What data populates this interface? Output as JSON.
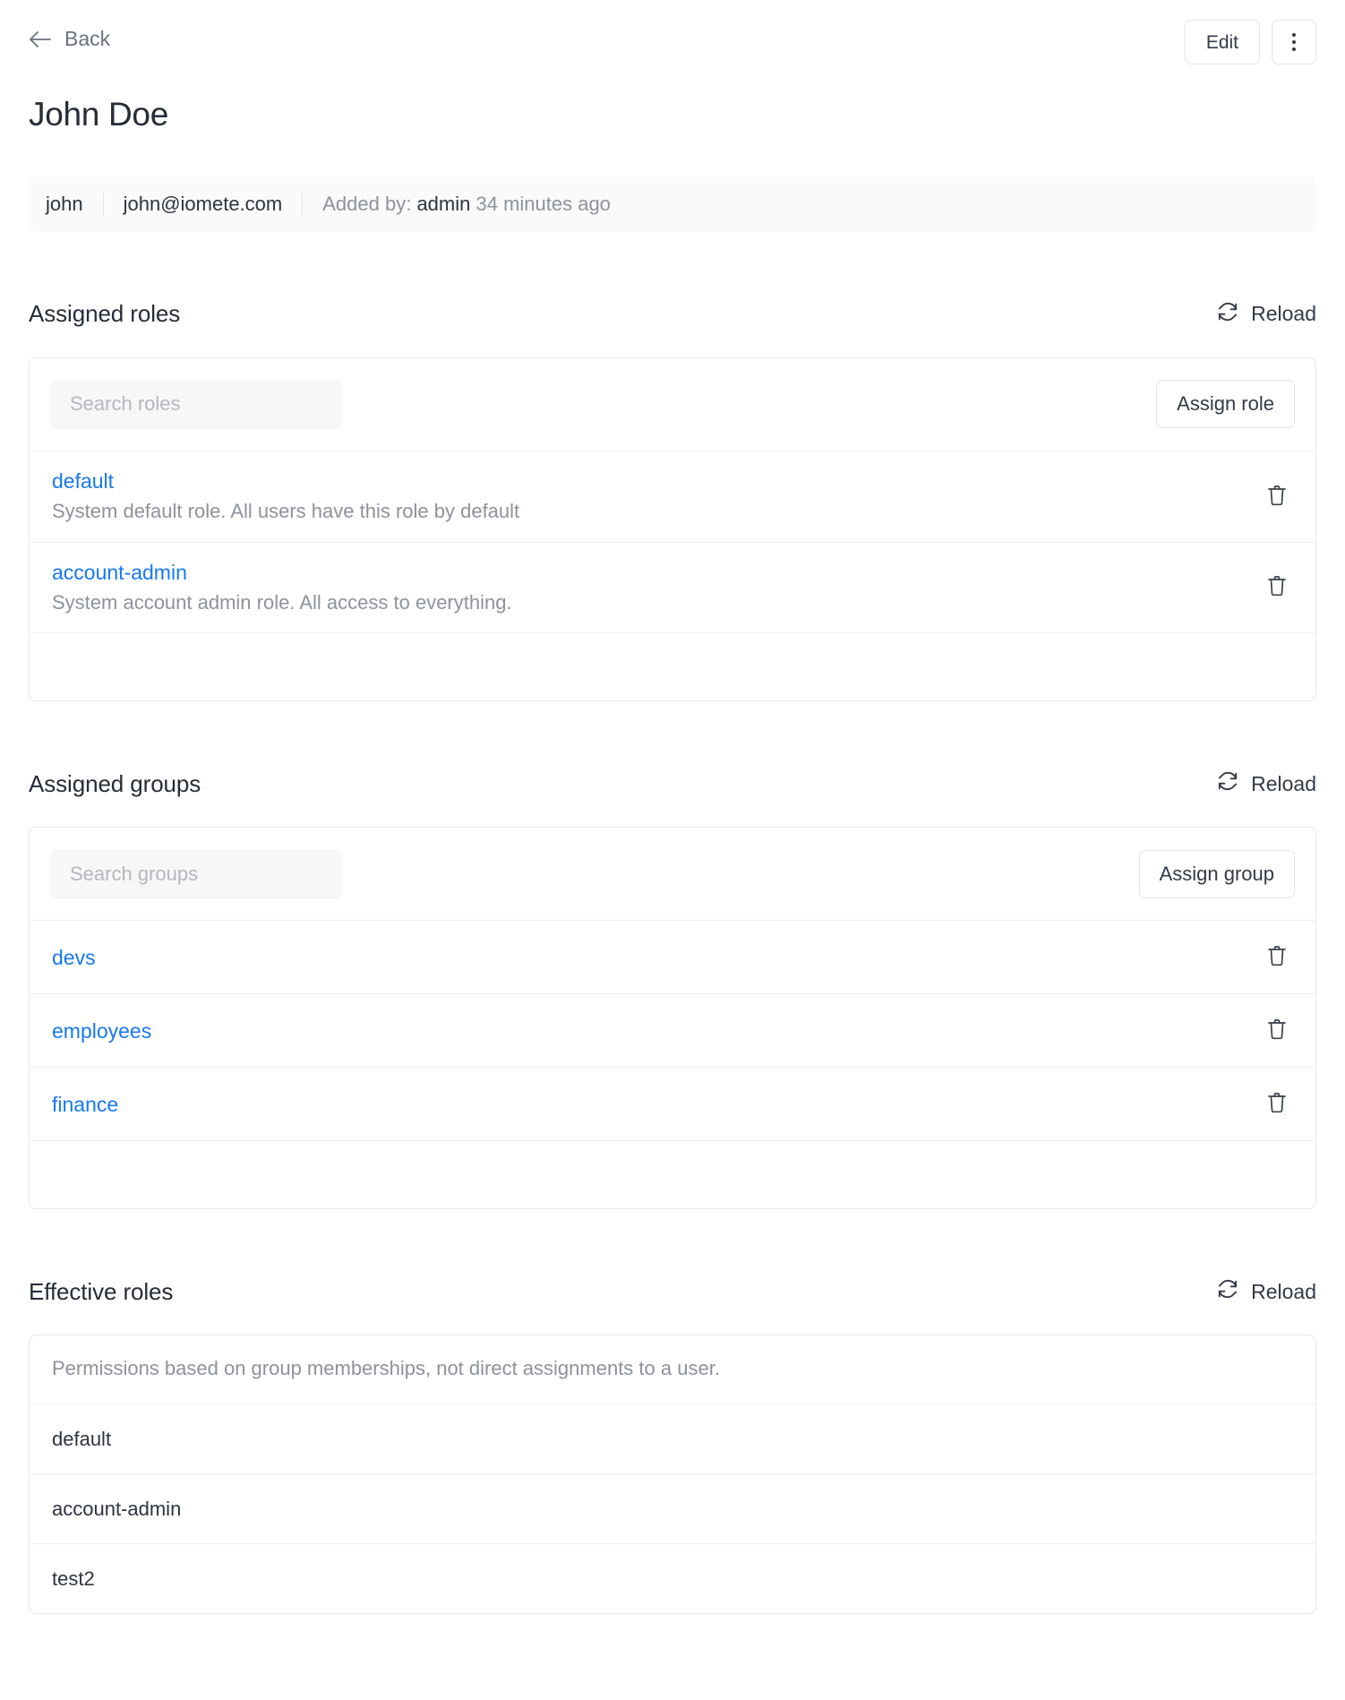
{
  "topbar": {
    "back_label": "Back",
    "back_icon": "arrow-left-icon",
    "edit_label": "Edit",
    "kebab_icon": "more-vertical-icon"
  },
  "page_title": "John Doe",
  "meta": {
    "username": "john",
    "email": "john@iomete.com",
    "added_by_label": "Added by:",
    "added_by_user": "admin",
    "added_ago": "34 minutes ago"
  },
  "assigned_roles": {
    "title": "Assigned roles",
    "reload_label": "Reload",
    "reload_icon": "refresh-icon",
    "search_placeholder": "Search roles",
    "search_value": "",
    "assign_label": "Assign role",
    "delete_icon": "trash-icon",
    "rows": [
      {
        "name": "default",
        "description": "System default role. All users have this role by default"
      },
      {
        "name": "account-admin",
        "description": "System account admin role. All access to everything."
      }
    ]
  },
  "assigned_groups": {
    "title": "Assigned groups",
    "reload_label": "Reload",
    "reload_icon": "refresh-icon",
    "search_placeholder": "Search groups",
    "search_value": "",
    "assign_label": "Assign group",
    "delete_icon": "trash-icon",
    "rows": [
      {
        "name": "devs"
      },
      {
        "name": "employees"
      },
      {
        "name": "finance"
      }
    ]
  },
  "effective_roles": {
    "title": "Effective roles",
    "reload_label": "Reload",
    "reload_icon": "refresh-icon",
    "note": "Permissions based on group memberships, not direct assignments to a user.",
    "rows": [
      {
        "name": "default"
      },
      {
        "name": "account-admin"
      },
      {
        "name": "test2"
      }
    ]
  },
  "colors": {
    "link": "#1778f2",
    "text": "#2d3340",
    "muted": "#8d929c",
    "border": "#e6e8ec",
    "meta_bg": "#fafafb",
    "input_bg": "#f7f7f8"
  }
}
